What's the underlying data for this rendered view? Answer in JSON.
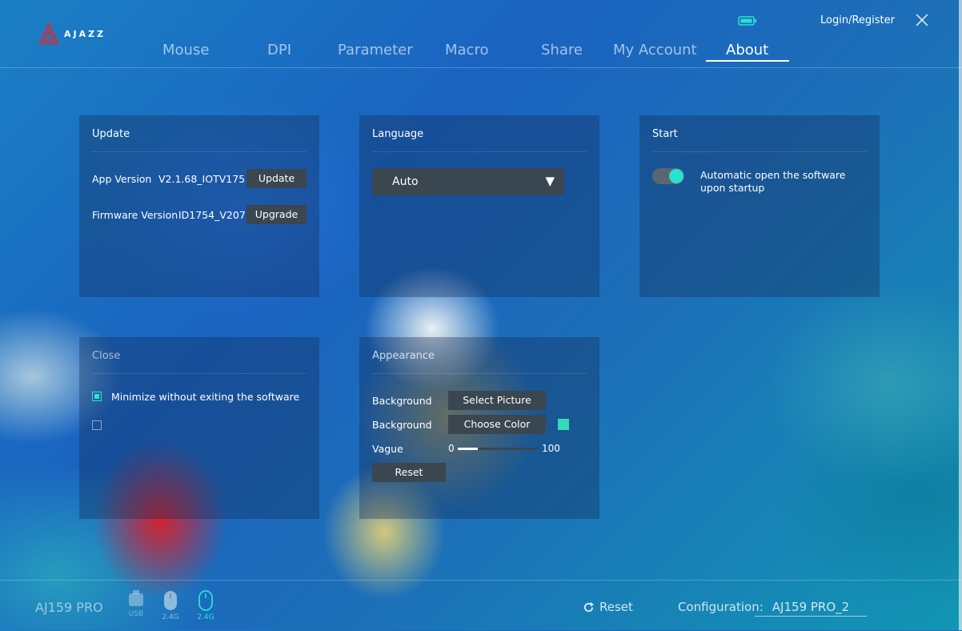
{
  "header": {
    "brand": "AJAZZ",
    "login_label": "Login/Register",
    "nav": [
      {
        "label": "Mouse"
      },
      {
        "label": "DPI"
      },
      {
        "label": "Parameter"
      },
      {
        "label": "Macro"
      },
      {
        "label": "Share"
      },
      {
        "label": "My Account"
      },
      {
        "label": "About"
      }
    ],
    "active_tab": "About"
  },
  "update": {
    "title": "Update",
    "app_version_label": "App Version",
    "app_version": "V2.1.68_IOTV175",
    "update_button": "Update",
    "firmware_version_label": "Firmware Version",
    "firmware_version": "ID1754_V207",
    "upgrade_button": "Upgrade"
  },
  "language": {
    "title": "Language",
    "selected": "Auto"
  },
  "start": {
    "title": "Start",
    "auto_open_label": "Automatic open the software upon startup",
    "auto_open_enabled": true
  },
  "close": {
    "title": "Close",
    "option_minimize": "Minimize without exiting the software",
    "option_minimize_checked": true,
    "option_exit_checked": false
  },
  "appearance": {
    "title": "Appearance",
    "background_label_1": "Background",
    "select_picture_button": "Select Picture",
    "background_label_2": "Background",
    "choose_color_button": "Choose Color",
    "color_value": "#38d8b8",
    "vague_label": "Vague",
    "vague_min": "0",
    "vague_max": "100",
    "vague_value": 25,
    "reset_button": "Reset"
  },
  "footer": {
    "device_name": "AJ159 PRO",
    "devices": [
      {
        "label": "USB",
        "active": false
      },
      {
        "label": "2.4G",
        "active": false
      },
      {
        "label": "2.4G",
        "active": true
      }
    ],
    "reset_label": "Reset",
    "configuration_label": "Configuration:",
    "configuration_value": "AJ159 PRO_2"
  },
  "colors": {
    "accent": "#27e3d0",
    "button_bg": "#3a4650"
  }
}
